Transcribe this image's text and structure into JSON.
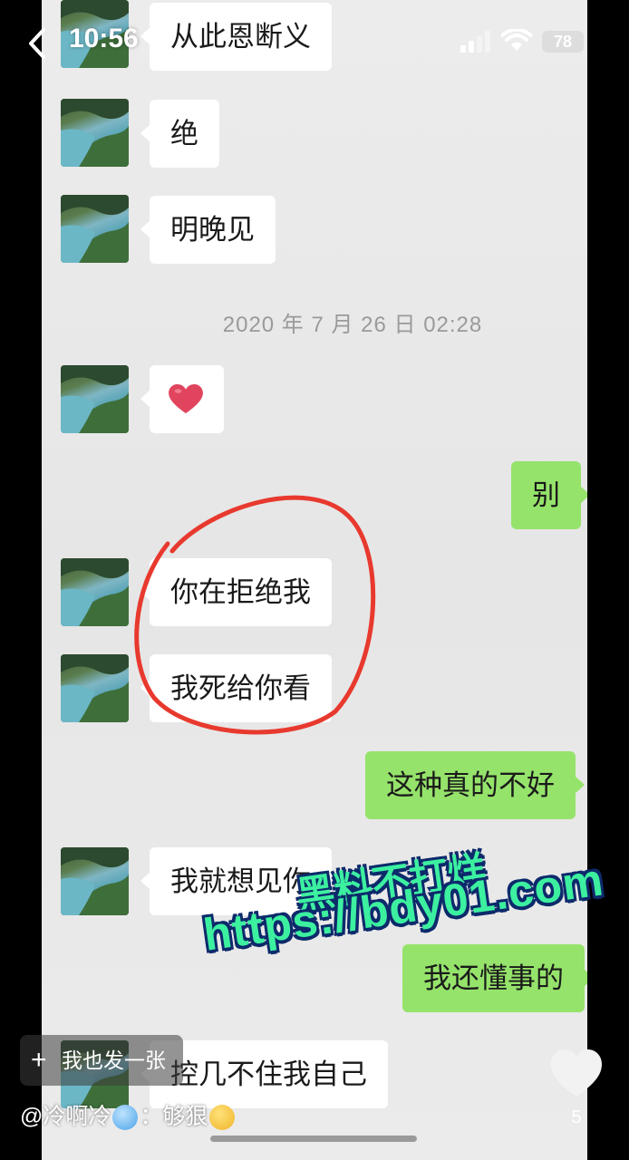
{
  "status_bar": {
    "time": "10:56",
    "battery": "78"
  },
  "messages": [
    {
      "side": "left",
      "text": "从此恩断义"
    },
    {
      "side": "left",
      "text": "绝"
    },
    {
      "side": "left",
      "text": "明晚见"
    },
    {
      "side": "left",
      "type": "emoji",
      "icon": "red-heart-icon"
    },
    {
      "side": "right",
      "text": "别"
    },
    {
      "side": "left",
      "text": "你在拒绝我"
    },
    {
      "side": "left",
      "text": "我死给你看"
    },
    {
      "side": "right",
      "text": "这种真的不好"
    },
    {
      "side": "left",
      "text": "我就想见你"
    },
    {
      "side": "right",
      "text": "我还懂事的"
    },
    {
      "side": "left",
      "text": "控几不住我自己"
    }
  ],
  "timestamp": "2020 年 7 月 26 日 02:28",
  "watermark": {
    "line1": "黑料不打烊",
    "line2": "https://bdy01.com"
  },
  "overlay": {
    "post_button_label": "我也发一张",
    "comment": {
      "user": "@冷啊冷",
      "separator": "：",
      "text": "够狠",
      "emojis": [
        "cold-face-icon",
        "scream-face-icon"
      ]
    },
    "like_count": "5"
  },
  "colors": {
    "sent_bubble": "#95e36b",
    "received_bubble": "#ffffff",
    "annotation_circle": "#e8392e",
    "watermark_fill": "#3cf0a0",
    "watermark_outline": "#0d2a6b"
  }
}
